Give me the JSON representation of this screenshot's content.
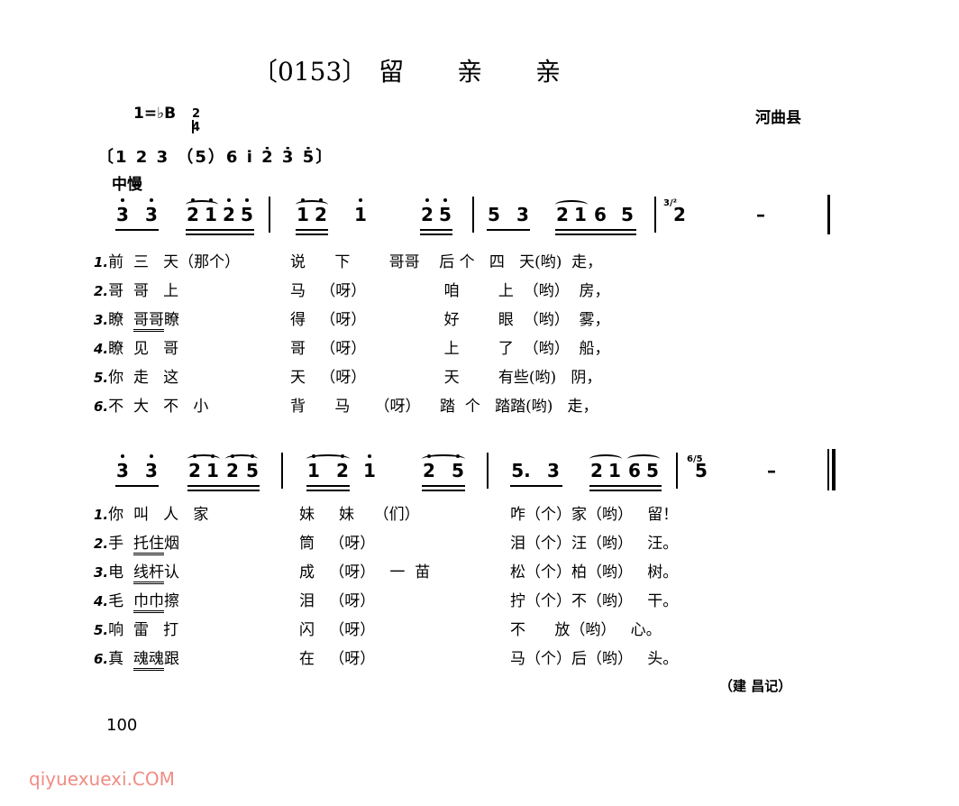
{
  "title": {
    "number": "〔0153〕",
    "chars": [
      "留",
      "亲",
      "亲"
    ]
  },
  "key": {
    "label": "1=♭B",
    "time_top": "2",
    "time_bottom": "4"
  },
  "region": "河曲县",
  "intro": "〔1 2 3 （5）6 i̇ 2̇ 3̇ 5̇〕",
  "tempo": "中慢",
  "system1": {
    "notes": [
      "3̇",
      "3̇",
      "2̇",
      "i̇",
      "2̇",
      "5̇",
      "i̇",
      "2̇",
      "i̇",
      "2̇",
      "5̇",
      "5",
      "3",
      "2",
      "1",
      "6",
      "5",
      "2",
      "–"
    ],
    "grace_note": "3/²",
    "lyrics": [
      {
        "num": "1.",
        "cells": [
          "前",
          "三",
          "天（那个）",
          "说",
          "下",
          "哥哥",
          "后",
          "个",
          "四",
          "天(哟)",
          "走，"
        ]
      },
      {
        "num": "2.",
        "cells": [
          "哥",
          "哥",
          "上",
          "马",
          "（呀）",
          "",
          "咱",
          "",
          "上",
          "（哟）",
          "房，"
        ]
      },
      {
        "num": "3.",
        "cells": [
          "瞭",
          "哥哥瞭",
          "",
          "得",
          "（呀）",
          "",
          "好",
          "",
          "眼",
          "（哟）",
          "雾，"
        ]
      },
      {
        "num": "4.",
        "cells": [
          "瞭",
          "见",
          "哥",
          "哥",
          "（呀）",
          "",
          "上",
          "",
          "了",
          "（哟）",
          "船，"
        ]
      },
      {
        "num": "5.",
        "cells": [
          "你",
          "走",
          "这",
          "天",
          "（呀）",
          "",
          "天",
          "",
          "有些(哟)",
          "",
          "阴，"
        ]
      },
      {
        "num": "6.",
        "cells": [
          "不",
          "大",
          "不",
          "小",
          "背",
          "马",
          "（呀）",
          "踏",
          "个",
          "踏踏(哟)",
          "走，"
        ]
      }
    ]
  },
  "system2": {
    "notes": [
      "3̇",
      "3̇",
      "2̇",
      "i̇",
      "2̇",
      "5̇",
      "i̇",
      "2̇",
      "i̇",
      "2̇",
      "5̇",
      "5.",
      "3",
      "2",
      "1",
      "6",
      "5",
      "5",
      "–"
    ],
    "grace_note": "6/5",
    "lyrics": [
      {
        "num": "1.",
        "cells": [
          "你",
          "叫",
          "人",
          "家",
          "妹",
          "妹",
          "（们）",
          "",
          "咋（个）家（哟）",
          "留！"
        ]
      },
      {
        "num": "2.",
        "cells": [
          "手",
          "托住",
          "烟",
          "",
          "筒",
          "（呀）",
          "",
          "",
          "泪（个）汪（哟）",
          "汪。"
        ]
      },
      {
        "num": "3.",
        "cells": [
          "电",
          "线杆",
          "认",
          "",
          "成",
          "（呀）",
          "一",
          "苗",
          "松（个）柏（哟）",
          "树。"
        ]
      },
      {
        "num": "4.",
        "cells": [
          "毛",
          "巾巾",
          "擦",
          "",
          "泪",
          "（呀）",
          "",
          "",
          "拧（个）不（哟）",
          "干。"
        ]
      },
      {
        "num": "5.",
        "cells": [
          "响",
          "雷",
          "打",
          "",
          "闪",
          "（呀）",
          "",
          "",
          "不 放（哟）",
          "心。"
        ]
      },
      {
        "num": "6.",
        "cells": [
          "真",
          "魂魂",
          "跟",
          "",
          "在",
          "（呀）",
          "",
          "",
          "马（个）后（哟）",
          "头。"
        ]
      }
    ]
  },
  "credit": "（建 昌记）",
  "page_number": "100",
  "watermark": "qiyuexuexi.COM"
}
